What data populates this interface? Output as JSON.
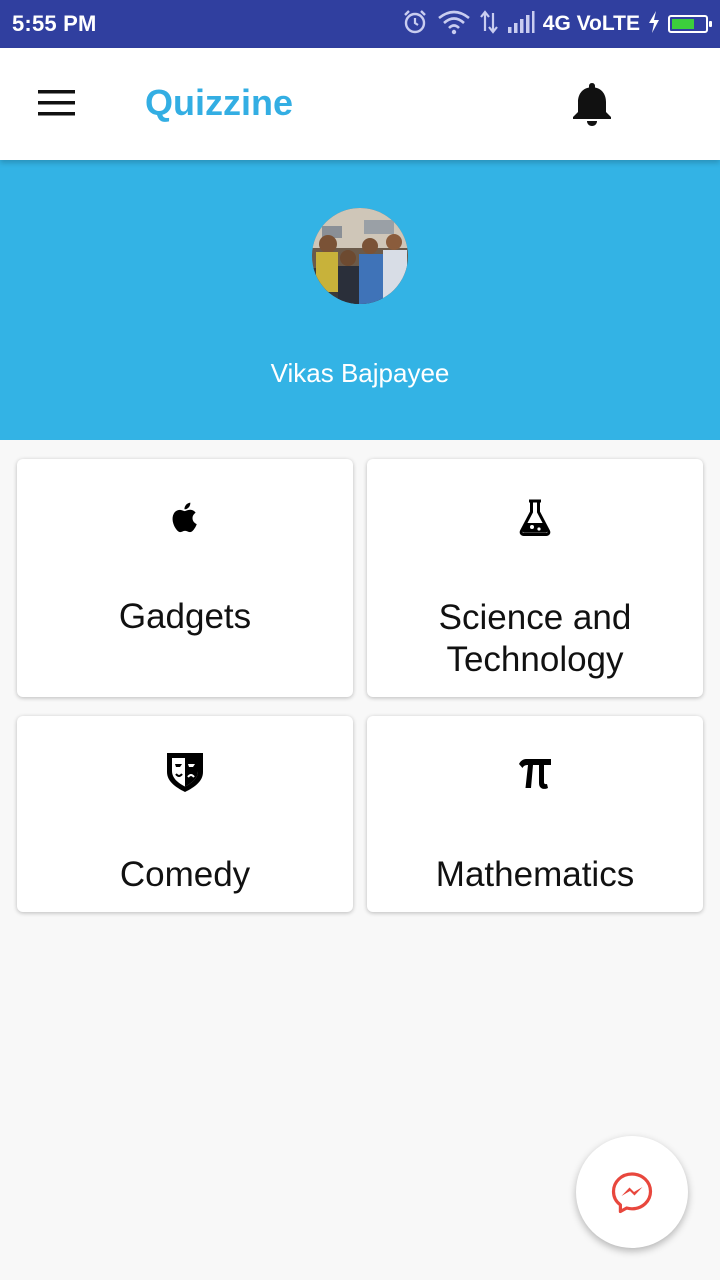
{
  "status_bar": {
    "time": "5:55 PM",
    "network_label": "4G VoLTE",
    "icons": [
      "alarm-icon",
      "wifi-icon",
      "data-transfer-icon",
      "signal-icon",
      "battery-charging-icon"
    ],
    "battery_level": 0.7
  },
  "toolbar": {
    "title": "Quizzine",
    "menu_icon": "hamburger-menu-icon",
    "notification_icon": "bell-icon"
  },
  "profile": {
    "name": "Vikas Bajpayee"
  },
  "categories": [
    {
      "label": "Gadgets",
      "icon": "apple-icon"
    },
    {
      "label": "Science and Technology",
      "label_line1": "Science and",
      "label_line2": "Technology",
      "icon": "flask-icon"
    },
    {
      "label": "Comedy",
      "icon": "theater-mask-icon"
    },
    {
      "label": "Mathematics",
      "icon": "pi-icon"
    }
  ],
  "fab": {
    "icon": "messenger-icon"
  },
  "colors": {
    "status_bar": "#303F9F",
    "accent": "#33aee3",
    "header_background": "#33b3e5",
    "page_background": "#f8f8f8",
    "messenger_icon": "#e8473d"
  }
}
